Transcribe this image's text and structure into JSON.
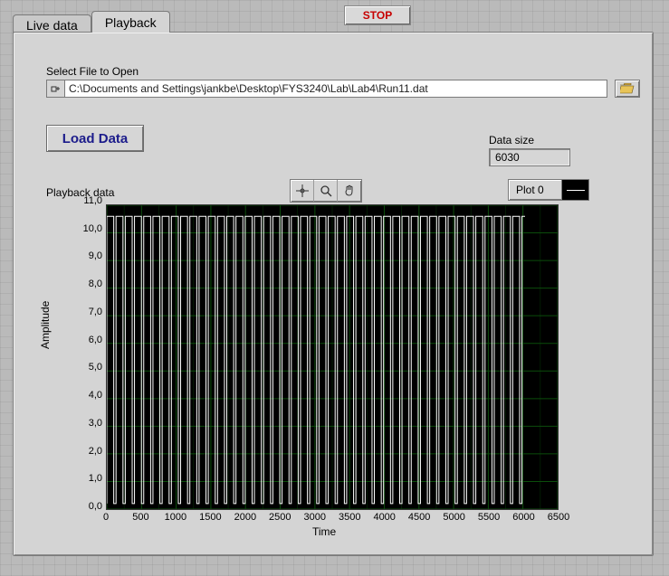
{
  "stop_label": "STOP",
  "tabs": {
    "live": "Live data",
    "playback": "Playback"
  },
  "file": {
    "label": "Select  File to Open",
    "path": "C:\\Documents and Settings\\jankbe\\Desktop\\FYS3240\\Lab\\Lab4\\Run11.dat"
  },
  "load_label": "Load  Data",
  "data_size": {
    "label": "Data size",
    "value": "6030"
  },
  "playback_label": "Playback data",
  "legend_label": "Plot 0",
  "chart_data": {
    "type": "line",
    "title": "",
    "xlabel": "Time",
    "ylabel": "Amplitude",
    "xlim": [
      0,
      6500
    ],
    "ylim": [
      0,
      11
    ],
    "x_ticks": [
      0,
      500,
      1000,
      1500,
      2000,
      2500,
      3000,
      3500,
      4000,
      4500,
      5000,
      5500,
      6000,
      6500
    ],
    "y_ticks": [
      0,
      1,
      2,
      3,
      4,
      5,
      6,
      7,
      8,
      9,
      10,
      11
    ],
    "y_tick_labels": [
      "0,0",
      "1,0",
      "2,0",
      "3,0",
      "4,0",
      "5,0",
      "6,0",
      "7,0",
      "8,0",
      "9,0",
      "10,0",
      "11,0"
    ],
    "series": [
      {
        "name": "Plot 0",
        "color": "#ffffff",
        "description": "square-wave signal, ~45 pulses between x=0 and x≈6000, low≈0.2 high≈10.6, flat 0 from 6000–6030",
        "n_samples": 6030,
        "high_value": 10.6,
        "low_value": 0.2,
        "period_samples": 133,
        "duty_cycle": 0.75,
        "data_extent_x": [
          0,
          6030
        ]
      }
    ],
    "grid": {
      "color": "#0b4d0b",
      "visible": true
    }
  }
}
